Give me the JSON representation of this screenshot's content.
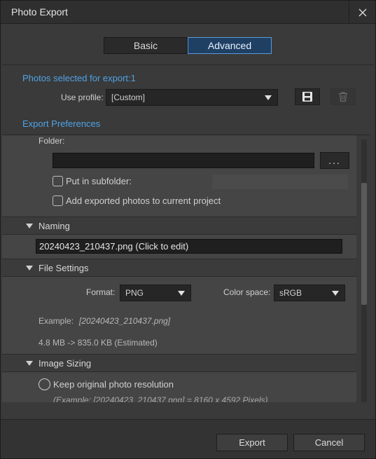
{
  "window": {
    "title": "Photo Export"
  },
  "tabs": [
    {
      "label": "Basic",
      "active": false
    },
    {
      "label": "Advanced",
      "active": true
    }
  ],
  "photos_selected": {
    "label": "Photos selected for export:",
    "count": "1"
  },
  "profile": {
    "label": "Use profile:",
    "value": "[Custom]"
  },
  "export_preferences": {
    "label": "Export Preferences"
  },
  "folder": {
    "label": "Folder:",
    "value": "",
    "browse_label": "..."
  },
  "subfolder": {
    "label": "Put in subfolder:",
    "checked": false,
    "value": ""
  },
  "add_to_project": {
    "label": "Add exported photos to current project",
    "checked": false
  },
  "naming": {
    "header": "Naming",
    "filename": "20240423_210437.png  (Click to edit)"
  },
  "file_settings": {
    "header": "File Settings",
    "format_label": "Format:",
    "format_value": "PNG",
    "color_space_label": "Color space:",
    "color_space_value": "sRGB",
    "example_label": "Example:",
    "example_value": "[20240423_210437.png]",
    "size_estimate": "4.8 MB -> 835.0 KB (Estimated)"
  },
  "image_sizing": {
    "header": "Image Sizing",
    "keep_original_label": "Keep original photo resolution",
    "example_text": "(Example: [20240423_210437.png] = 8160 x 4592 Pixels)"
  },
  "footer": {
    "export_label": "Export",
    "cancel_label": "Cancel"
  },
  "colors": {
    "accent": "#4fa3e6",
    "active_tab_bg": "#1f3f63",
    "active_tab_border": "#5a9ad8"
  }
}
